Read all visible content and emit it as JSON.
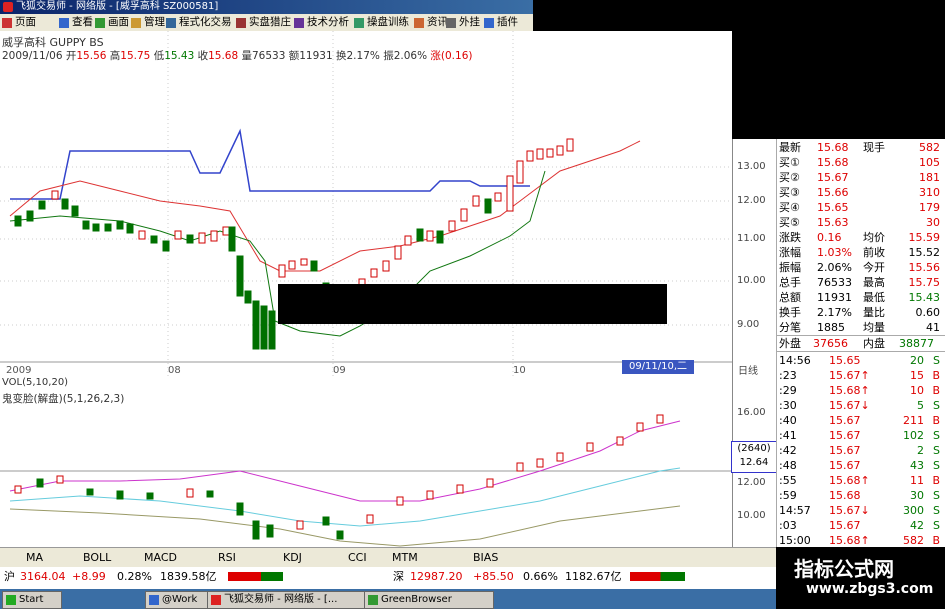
{
  "window": {
    "title": "飞狐交易师 - 网络版 - [威孚高科 SZ000581]"
  },
  "menu": [
    {
      "label": "页面",
      "icon": "page-icon"
    },
    {
      "label": "查看",
      "icon": "view-icon"
    },
    {
      "label": "画面",
      "icon": "screen-icon"
    },
    {
      "label": "管理",
      "icon": "manage-icon"
    },
    {
      "label": "程式化交易",
      "icon": "program-trade-icon"
    },
    {
      "label": "实盘猎庄",
      "icon": "live-hunt-icon"
    },
    {
      "label": "技术分析",
      "icon": "tech-analysis-icon"
    },
    {
      "label": "操盘训练",
      "icon": "training-icon"
    },
    {
      "label": "资讯",
      "icon": "news-icon"
    },
    {
      "label": "外挂",
      "icon": "plugin-icon"
    },
    {
      "label": "插件",
      "icon": "addon-icon"
    }
  ],
  "chart_header": {
    "name": "威孚高科 GUPPY BS",
    "date": "2009/11/06",
    "open_label": "开",
    "open": "15.56",
    "high_label": "高",
    "high": "15.75",
    "low_label": "低",
    "low": "15.43",
    "close_label": "收",
    "close": "15.68",
    "vol_label": "量",
    "vol": "76533",
    "amount_label": "额",
    "amount": "11931",
    "turnover_label": "换",
    "turnover": "2.17%",
    "amplitude_label": "振",
    "amplitude": "2.06%",
    "change_label": "涨",
    "change": "(0.16)"
  },
  "price_axis": [
    "13.00",
    "12.00",
    "11.00",
    "10.00",
    "9.00"
  ],
  "date_axis": [
    "2009",
    "08",
    "09",
    "10"
  ],
  "date_flag": "09/11/10,二",
  "period_label": "日线",
  "vol_header": "VOL(5,10,20)",
  "ghost_header": "鬼变脸(解盘)(5,1,26,2,3)",
  "lower_axis": [
    "16.00",
    "12.00",
    "10.00"
  ],
  "cur_value_box": {
    "line1": "(2640)",
    "line2": "12.64"
  },
  "quote": {
    "rows": [
      {
        "l1": "最新",
        "v1": "15.68",
        "l2": "现手",
        "v2": "582",
        "c1": "red",
        "c2": "red"
      },
      {
        "l1": "买①",
        "v1": "15.68",
        "l2": "",
        "v2": "105",
        "c1": "red",
        "c2": "red"
      },
      {
        "l1": "买②",
        "v1": "15.67",
        "l2": "",
        "v2": "181",
        "c1": "red",
        "c2": "red"
      },
      {
        "l1": "买③",
        "v1": "15.66",
        "l2": "",
        "v2": "310",
        "c1": "red",
        "c2": "red"
      },
      {
        "l1": "买④",
        "v1": "15.65",
        "l2": "",
        "v2": "179",
        "c1": "red",
        "c2": "red"
      },
      {
        "l1": "买⑤",
        "v1": "15.63",
        "l2": "",
        "v2": "30",
        "c1": "red",
        "c2": "red"
      },
      {
        "l1": "涨跌",
        "v1": "0.16",
        "l2": "均价",
        "v2": "15.59",
        "c1": "red",
        "c2": "red"
      },
      {
        "l1": "涨幅",
        "v1": "1.03%",
        "l2": "前收",
        "v2": "15.52",
        "c1": "red",
        "c2": "black"
      },
      {
        "l1": "振幅",
        "v1": "2.06%",
        "l2": "今开",
        "v2": "15.56",
        "c1": "black",
        "c2": "red"
      },
      {
        "l1": "总手",
        "v1": "76533",
        "l2": "最高",
        "v2": "15.75",
        "c1": "black",
        "c2": "red"
      },
      {
        "l1": "总额",
        "v1": "11931",
        "l2": "最低",
        "v2": "15.43",
        "c1": "black",
        "c2": "green"
      },
      {
        "l1": "换手",
        "v1": "2.17%",
        "l2": "量比",
        "v2": "0.60",
        "c1": "black",
        "c2": "black"
      },
      {
        "l1": "分笔",
        "v1": "1885",
        "l2": "均量",
        "v2": "41",
        "c1": "black",
        "c2": "black"
      }
    ],
    "outer_label": "外盘",
    "outer": "37656",
    "inner_label": "内盘",
    "inner": "38877",
    "ticks": [
      {
        "t": "14:56",
        "p": "15.65",
        "v": "20",
        "d": "S"
      },
      {
        "t": ":23",
        "p": "15.67↑",
        "v": "15",
        "d": "B"
      },
      {
        "t": ":29",
        "p": "15.68↑",
        "v": "10",
        "d": "B"
      },
      {
        "t": ":30",
        "p": "15.67↓",
        "v": "5",
        "d": "S"
      },
      {
        "t": ":40",
        "p": "15.67",
        "v": "211",
        "d": "B"
      },
      {
        "t": ":41",
        "p": "15.67",
        "v": "102",
        "d": "S"
      },
      {
        "t": ":42",
        "p": "15.67",
        "v": "2",
        "d": "S"
      },
      {
        "t": ":48",
        "p": "15.67",
        "v": "43",
        "d": "S"
      },
      {
        "t": ":55",
        "p": "15.68↑",
        "v": "11",
        "d": "B"
      },
      {
        "t": ":59",
        "p": "15.68",
        "v": "30",
        "d": "S"
      },
      {
        "t": "14:57",
        "p": "15.67↓",
        "v": "300",
        "d": "S"
      },
      {
        "t": ":03",
        "p": "15.67",
        "v": "42",
        "d": "S"
      },
      {
        "t": "15:00",
        "p": "15.68↑",
        "v": "582",
        "d": "B"
      }
    ]
  },
  "tabs": [
    "MA",
    "BOLL",
    "MACD",
    "RSI",
    "KDJ",
    "CCI",
    "MTM",
    "BIAS"
  ],
  "index_bar": {
    "sh_label": "沪",
    "sh": "3164.04",
    "sh_chg": "+8.99",
    "sh_pct": "0.28%",
    "sh_amt": "1839.58亿",
    "sz_label": "深",
    "sz": "12987.20",
    "sz_chg": "+85.50",
    "sz_pct": "0.66%",
    "sz_amt": "1182.67亿"
  },
  "taskbar": [
    {
      "label": "Start",
      "icon": "start-icon"
    },
    {
      "label": "@Work",
      "icon": "work-icon"
    },
    {
      "label": "飞狐交易师 - 网络版 - [...",
      "icon": "app-icon"
    },
    {
      "label": "GreenBrowser",
      "icon": "browser-icon"
    }
  ],
  "watermark": {
    "line1": "指标公式网",
    "line2": "www.zbgs3.com"
  },
  "colors": {
    "up": "#d00000",
    "down": "#007000",
    "blue_line": "#3344cc",
    "red_line": "#dd3333",
    "green_line": "#117711"
  }
}
